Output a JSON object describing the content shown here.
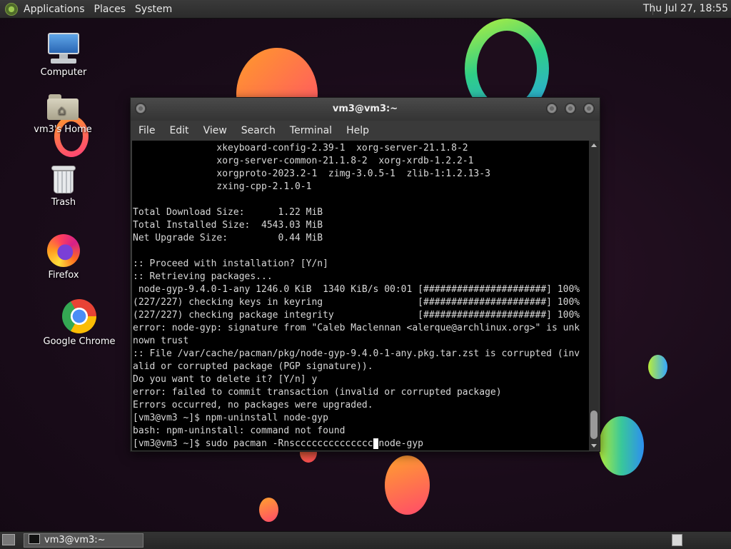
{
  "top_panel": {
    "menus": [
      "Applications",
      "Places",
      "System"
    ],
    "clock": "Thu Jul 27, 18:55"
  },
  "desktop_icons": [
    {
      "label": "Computer",
      "icon": "computer-icon"
    },
    {
      "label": "vm3's Home",
      "icon": "home-folder-icon"
    },
    {
      "label": "Trash",
      "icon": "trash-icon"
    },
    {
      "label": "Firefox",
      "icon": "firefox-icon"
    },
    {
      "label": "Google Chrome",
      "icon": "chrome-icon"
    }
  ],
  "terminal": {
    "title": "vm3@vm3:~",
    "menus": [
      "File",
      "Edit",
      "View",
      "Search",
      "Terminal",
      "Help"
    ],
    "lines": [
      "               xkeyboard-config-2.39-1  xorg-server-21.1.8-2",
      "               xorg-server-common-21.1.8-2  xorg-xrdb-1.2.2-1",
      "               xorgproto-2023.2-1  zimg-3.0.5-1  zlib-1:1.2.13-3",
      "               zxing-cpp-2.1.0-1",
      "",
      "Total Download Size:      1.22 MiB",
      "Total Installed Size:  4543.03 MiB",
      "Net Upgrade Size:         0.44 MiB",
      "",
      ":: Proceed with installation? [Y/n]",
      ":: Retrieving packages...",
      " node-gyp-9.4.0-1-any 1246.0 KiB  1340 KiB/s 00:01 [######################] 100%",
      "(227/227) checking keys in keyring                 [######################] 100%",
      "(227/227) checking package integrity               [######################] 100%",
      "error: node-gyp: signature from \"Caleb Maclennan <alerque@archlinux.org>\" is unk",
      "nown trust",
      ":: File /var/cache/pacman/pkg/node-gyp-9.4.0-1-any.pkg.tar.zst is corrupted (inv",
      "alid or corrupted package (PGP signature)).",
      "Do you want to delete it? [Y/n] y",
      "error: failed to commit transaction (invalid or corrupted package)",
      "Errors occurred, no packages were upgraded.",
      "[vm3@vm3 ~]$ npm-uninstall node-gyp",
      "bash: npm-uninstall: command not found"
    ],
    "prompt_line_before_cursor": "[vm3@vm3 ~]$ sudo pacman -Rnscccccccccccccc",
    "prompt_line_after_cursor": "node-gyp"
  },
  "taskbar": {
    "tasks": [
      {
        "label": "vm3@vm3:~",
        "icon": "terminal-icon"
      }
    ]
  }
}
